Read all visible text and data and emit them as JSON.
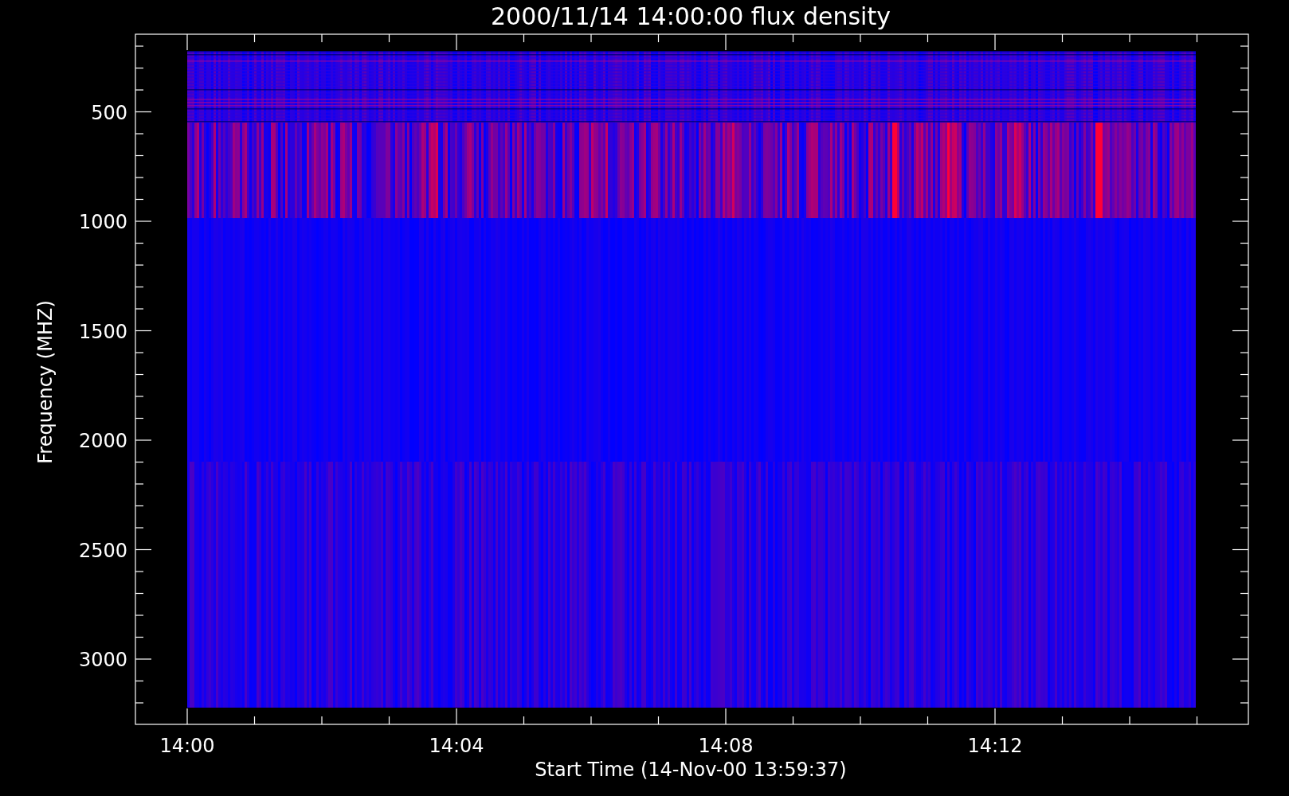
{
  "title": "2000/11/14 14:00:00 flux density",
  "y_axis": {
    "label": "Frequency (MHZ)",
    "ticks": [
      "500",
      "1000",
      "1500",
      "2000",
      "2500",
      "3000"
    ]
  },
  "x_axis": {
    "label": "Start Time (14-Nov-00 13:59:37)",
    "ticks": [
      "14:00",
      "14:04",
      "14:08",
      "14:12"
    ]
  }
}
